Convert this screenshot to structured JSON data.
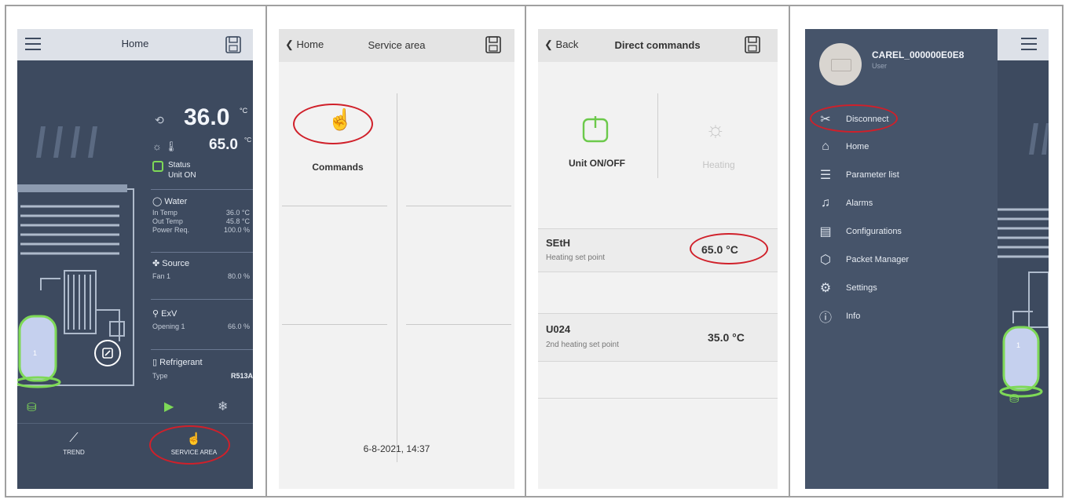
{
  "panel1": {
    "header": {
      "title": "Home"
    },
    "temps": {
      "main_value": "36.0",
      "main_unit": "°C",
      "setpoint_value": "65.0",
      "setpoint_unit": "°C"
    },
    "status": {
      "label": "Status",
      "value": "Unit ON"
    },
    "water": {
      "title": "Water",
      "rows": [
        {
          "label": "In Temp",
          "value": "36.0 °C"
        },
        {
          "label": "Out Temp",
          "value": "45.8 °C"
        },
        {
          "label": "Power Req.",
          "value": "100.0 %"
        }
      ]
    },
    "source": {
      "title": "Source",
      "rows": [
        {
          "label": "Fan 1",
          "value": "80.0 %"
        }
      ]
    },
    "exv": {
      "title": "ExV",
      "rows": [
        {
          "label": "Opening 1",
          "value": "66.0 %"
        }
      ]
    },
    "refrigerant": {
      "title": "Refrigerant",
      "rows": [
        {
          "label": "Type",
          "value": "R513A"
        }
      ]
    },
    "compressor_label": "1",
    "bottom_nav": {
      "trend": "TREND",
      "service": "SERVICE AREA"
    }
  },
  "panel2": {
    "header": {
      "back": "Home",
      "title": "Service area"
    },
    "tile": {
      "label": "Commands"
    },
    "datetime": "6-8-2021, 14:37"
  },
  "panel3": {
    "header": {
      "back": "Back",
      "title": "Direct commands"
    },
    "unit_on_off": "Unit ON/OFF",
    "heating": "Heating",
    "params": [
      {
        "code": "SEtH",
        "desc": "Heating set point",
        "value": "65.0 °C"
      },
      {
        "code": "U024",
        "desc": "2nd heating set point",
        "value": "35.0 °C"
      }
    ]
  },
  "panel4": {
    "device_name": "CAREL_000000E0E8",
    "role": "User",
    "menu": [
      {
        "label": "Disconnect",
        "icon": "disconnect-icon"
      },
      {
        "label": "Home",
        "icon": "home-icon"
      },
      {
        "label": "Parameter list",
        "icon": "list-icon"
      },
      {
        "label": "Alarms",
        "icon": "bell-icon"
      },
      {
        "label": "Configurations",
        "icon": "clipboard-icon"
      },
      {
        "label": "Packet Manager",
        "icon": "package-icon"
      },
      {
        "label": "Settings",
        "icon": "gear-icon"
      },
      {
        "label": "Info",
        "icon": "info-icon"
      }
    ],
    "compressor_label": "1"
  },
  "colors": {
    "dark_bg": "#3d4a5f",
    "accent_green": "#7ed957",
    "highlight": "#d0202a"
  }
}
